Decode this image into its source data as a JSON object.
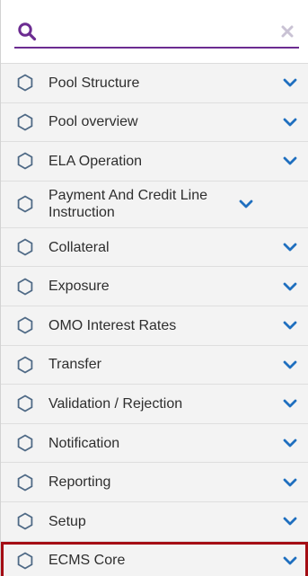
{
  "colors": {
    "accent": "#6c2c91",
    "chevron": "#1f6fbf",
    "highlight_border": "#a40d14",
    "item_text": "#2e2e2e",
    "item_icon": "#4f6a86"
  },
  "search": {
    "placeholder": "",
    "value": ""
  },
  "menu": {
    "items": [
      {
        "label": "Pool Structure",
        "icon": "hexagon-icon",
        "chevron": "chevron-down-icon"
      },
      {
        "label": "Pool overview",
        "icon": "hexagon-icon",
        "chevron": "chevron-down-icon"
      },
      {
        "label": "ELA Operation",
        "icon": "hexagon-icon",
        "chevron": "chevron-down-icon"
      },
      {
        "label": "Payment And Credit Line Instruction",
        "icon": "hexagon-icon",
        "chevron": "chevron-down-icon"
      },
      {
        "label": "Collateral",
        "icon": "hexagon-icon",
        "chevron": "chevron-down-icon"
      },
      {
        "label": "Exposure",
        "icon": "hexagon-icon",
        "chevron": "chevron-down-icon"
      },
      {
        "label": "OMO Interest Rates",
        "icon": "hexagon-icon",
        "chevron": "chevron-down-icon"
      },
      {
        "label": "Transfer",
        "icon": "hexagon-icon",
        "chevron": "chevron-down-icon"
      },
      {
        "label": "Validation / Rejection",
        "icon": "hexagon-icon",
        "chevron": "chevron-down-icon"
      },
      {
        "label": "Notification",
        "icon": "hexagon-icon",
        "chevron": "chevron-down-icon"
      },
      {
        "label": "Reporting",
        "icon": "hexagon-icon",
        "chevron": "chevron-down-icon"
      },
      {
        "label": "Setup",
        "icon": "hexagon-icon",
        "chevron": "chevron-down-icon"
      },
      {
        "label": "ECMS Core",
        "icon": "hexagon-icon",
        "chevron": "chevron-down-icon"
      }
    ]
  }
}
